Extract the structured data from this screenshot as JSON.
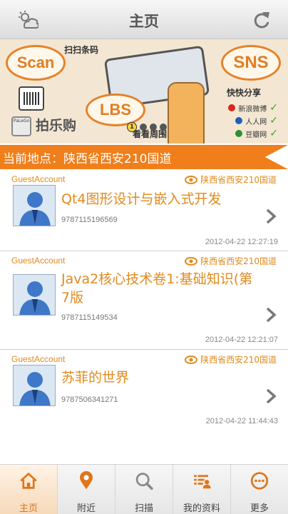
{
  "header": {
    "title": "主页",
    "left_icon": "weather-icon",
    "right_icon": "refresh-icon"
  },
  "banner": {
    "scan_label": "Scan",
    "scan_caption": "扫扫条码",
    "sns_label": "SNS",
    "sns_caption": "快快分享",
    "lbs_label": "LBS",
    "lbs_caption": "看看周围",
    "brand_cn": "拍乐购",
    "brand_logo_text": "PaLeGo",
    "social": [
      "新浪微博",
      "人人网",
      "豆瓣网"
    ],
    "page_indicator": "1"
  },
  "location": {
    "text": "当前地点：陕西省西安210国道"
  },
  "items": [
    {
      "account": "GuestAccount",
      "place": "陕西省西安210国道",
      "title": "Qt4图形设计与嵌入式开发",
      "isbn": "9787115196569",
      "time": "2012-04-22 12:27:19"
    },
    {
      "account": "GuestAccount",
      "place": "陕西省西安210国道",
      "title": "Java2核心技术卷1:基础知识(第7版",
      "isbn": "9787115149534",
      "time": "2012-04-22 12:21:07"
    },
    {
      "account": "GuestAccount",
      "place": "陕西省西安210国道",
      "title": "苏菲的世界",
      "isbn": "9787506341271",
      "time": "2012-04-22 11:44:43"
    }
  ],
  "tabs": [
    {
      "label": "主页",
      "icon": "home-icon",
      "active": true
    },
    {
      "label": "附近",
      "icon": "location-pin-icon",
      "active": false
    },
    {
      "label": "扫描",
      "icon": "magnifier-icon",
      "active": false
    },
    {
      "label": "我的资料",
      "icon": "profile-list-icon",
      "active": false
    },
    {
      "label": "更多",
      "icon": "more-icon",
      "active": false
    }
  ],
  "colors": {
    "accent": "#f07e1a",
    "item_text": "#e28a1c"
  }
}
